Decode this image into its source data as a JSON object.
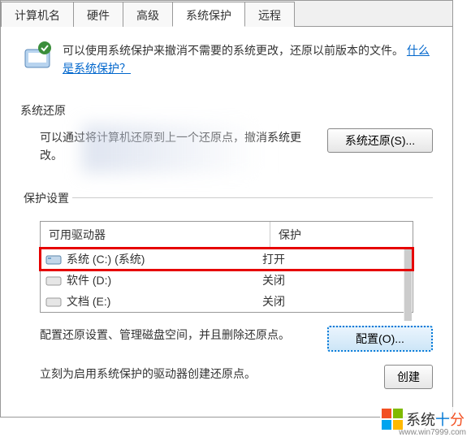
{
  "tabs": [
    {
      "label": "计算机名"
    },
    {
      "label": "硬件"
    },
    {
      "label": "高级"
    },
    {
      "label": "系统保护"
    },
    {
      "label": "远程"
    }
  ],
  "intro": {
    "text_part1": "可以使用系统保护来撤消不需要的系统更改，还原以前版本的文件。",
    "link_text": "什么是系统保护？"
  },
  "restore": {
    "heading": "系统还原",
    "text": "可以通过将计算机还原到上一个还原点，撤消系统更改。",
    "button": "系统还原(S)..."
  },
  "settings": {
    "heading": "保护设置",
    "header_drive": "可用驱动器",
    "header_status": "保护",
    "drives": [
      {
        "name": "系统 (C:) (系统)",
        "status": "打开",
        "highlighted": true,
        "icon": "drive-system"
      },
      {
        "name": "软件 (D:)",
        "status": "关闭",
        "highlighted": false,
        "icon": "drive"
      },
      {
        "name": "文档 (E:)",
        "status": "关闭",
        "highlighted": false,
        "icon": "drive"
      }
    ]
  },
  "config": {
    "text": "配置还原设置、管理磁盘空间，并且删除还原点。",
    "button": "配置(O)..."
  },
  "create": {
    "text": "立刻为启用系统保护的驱动器创建还原点。",
    "button": "创建"
  },
  "watermark": {
    "text": "系统",
    "url": "www.win7999.com"
  }
}
